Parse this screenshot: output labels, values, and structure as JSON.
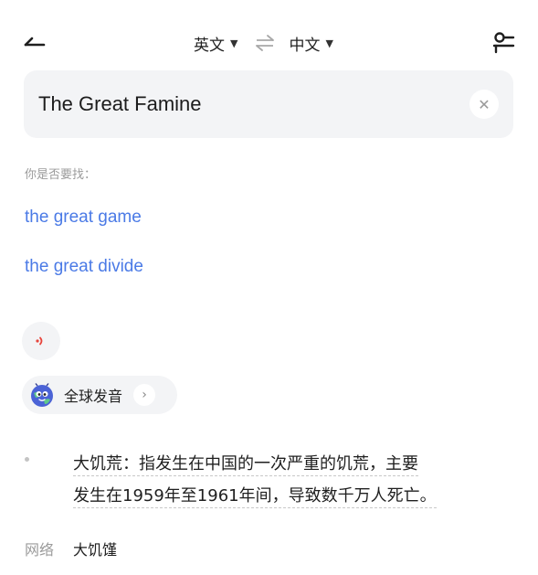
{
  "topbar": {
    "source_lang": "英文",
    "target_lang": "中文"
  },
  "search": {
    "value": "The Great Famine"
  },
  "suggestions": {
    "label": "你是否要找：",
    "items": [
      "the great game",
      "the great divide"
    ]
  },
  "pronunciation": {
    "global_label": "全球发音"
  },
  "definition": {
    "lines": [
      "大饥荒：指发生在中国的一次严重的饥荒，主要",
      "发生在1959年至1961年间，导致数千万人死亡。"
    ]
  },
  "network": {
    "label": "网络",
    "value": "大饥馑"
  },
  "colors": {
    "link": "#4a7ae6",
    "speaker": "#e8453c",
    "panel_bg": "#f3f4f6"
  }
}
